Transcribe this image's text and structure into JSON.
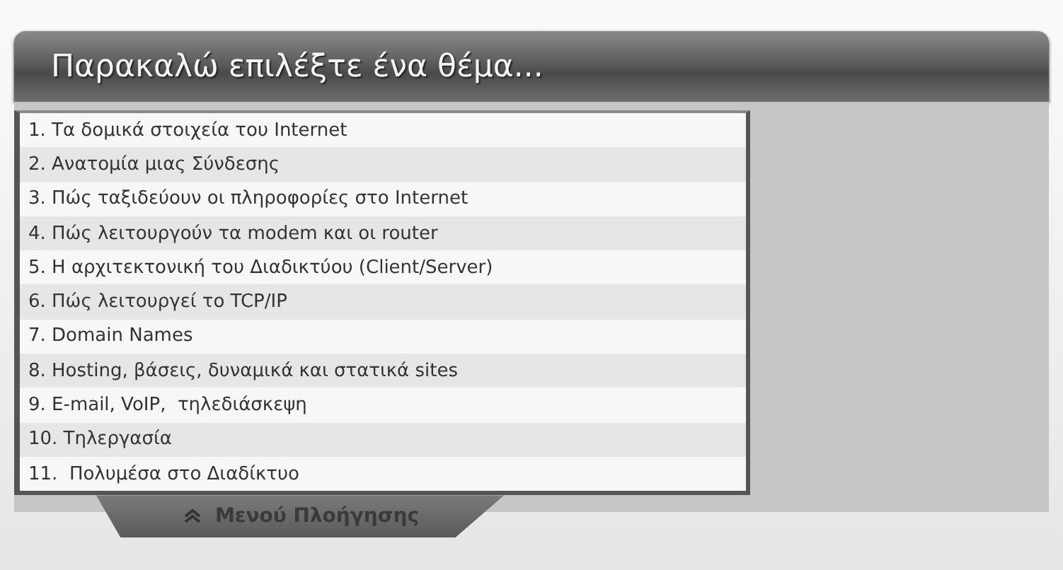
{
  "header": {
    "title": "Παρακαλώ επιλέξτε ένα θέμα..."
  },
  "topics": [
    {
      "label": "1. Τα δομικά στοιχεία του Internet"
    },
    {
      "label": "2. Ανατομία μιας Σύνδεσης"
    },
    {
      "label": "3. Πώς ταξιδεύουν οι πληροφορίες στο Internet"
    },
    {
      "label": "4. Πώς λειτουργούν τα modem και οι router"
    },
    {
      "label": "5. Η αρχιτεκτονική του Διαδικτύου (Client/Server)"
    },
    {
      "label": "6. Πώς λειτουργεί το TCP/IP"
    },
    {
      "label": "7. Domain Names"
    },
    {
      "label": "8. Hosting, βάσεις, δυναμικά και στατικά sites"
    },
    {
      "label": "9. E-mail, VoIP,  τηλεδιάσκεψη"
    },
    {
      "label": "10. Τηλεργασία"
    },
    {
      "label": "11.  Πολυμέσα στο Διαδίκτυο"
    }
  ],
  "nav_tab": {
    "label": "Μενού Πλοήγησης"
  }
}
